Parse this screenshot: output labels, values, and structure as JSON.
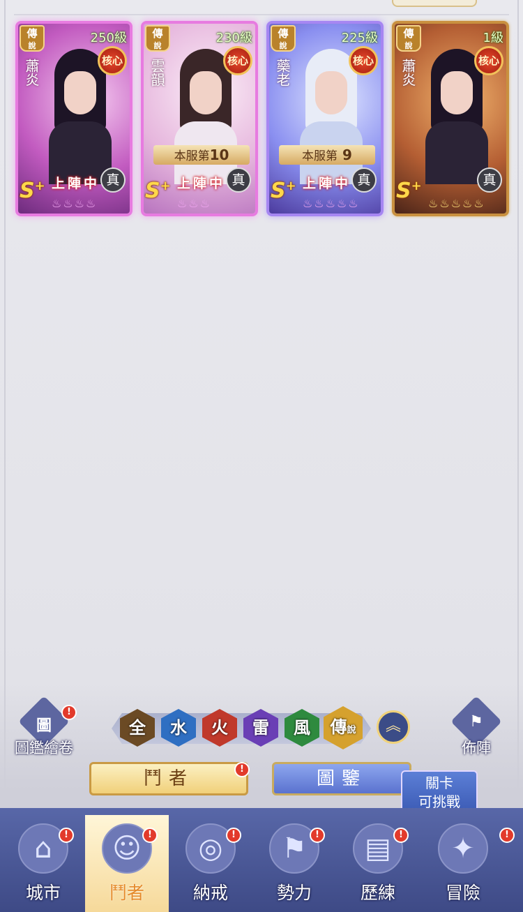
{
  "cards": [
    {
      "rarity_top": "傳",
      "rarity_bottom": "說",
      "level": "250級",
      "core": "核心",
      "name": "蕭炎",
      "rank": "",
      "deploy": "上陣中",
      "grade": "S",
      "grade_plus": "+",
      "true_label": "真",
      "stars": "♨♨♨♨",
      "theme": "pink"
    },
    {
      "rarity_top": "傳",
      "rarity_bottom": "說",
      "level": "230級",
      "core": "核心",
      "name": "雲韻",
      "rank_prefix": "本服第",
      "rank_num": "10",
      "deploy": "上陣中",
      "grade": "S",
      "grade_plus": "+",
      "true_label": "真",
      "stars": "♨♨♨",
      "theme": "pale"
    },
    {
      "rarity_top": "傳",
      "rarity_bottom": "說",
      "level": "225級",
      "core": "核心",
      "name": "藥老",
      "rank_prefix": "本服第",
      "rank_num": " 9",
      "deploy": "上陣中",
      "grade": "S",
      "grade_plus": "+",
      "true_label": "真",
      "stars": "♨♨♨♨♨",
      "theme": "purple"
    },
    {
      "rarity_top": "傳",
      "rarity_bottom": "說",
      "level": "1級",
      "core": "核心",
      "name": "蕭炎",
      "rank": "",
      "deploy": "",
      "grade": "S",
      "grade_plus": "+",
      "true_label": "真",
      "stars": "♨♨♨♨♨",
      "theme": "gold"
    }
  ],
  "left_button": {
    "glyph": "圖",
    "label": "圖鑑繪卷",
    "badge": "!"
  },
  "right_button": {
    "glyph": "⚑",
    "label": "佈陣"
  },
  "filters": [
    {
      "label": "全",
      "color": "#6b4a24"
    },
    {
      "label": "水",
      "color": "#2f6fc2"
    },
    {
      "label": "火",
      "color": "#c0392b"
    },
    {
      "label": "雷",
      "color": "#6a3fb5"
    },
    {
      "label": "風",
      "color": "#2e8a3e"
    },
    {
      "label": "傳",
      "sub": "說",
      "color": "#d5a12e",
      "active": true
    }
  ],
  "collapse_icon": "︽",
  "buttons": {
    "fighter": "鬥者",
    "codex": "圖鑒",
    "fighter_badge": "!"
  },
  "tooltip": {
    "line1": "關卡",
    "line2": "可挑戰"
  },
  "nav": [
    {
      "label": "城市",
      "sym": "⌂",
      "badge": "!"
    },
    {
      "label": "鬥者",
      "sym": "☺",
      "badge": "!",
      "active": true
    },
    {
      "label": "納戒",
      "sym": "◎",
      "badge": "!"
    },
    {
      "label": "勢力",
      "sym": "⚑",
      "badge": "!"
    },
    {
      "label": "歷練",
      "sym": "▤",
      "badge": "!"
    },
    {
      "label": "冒險",
      "sym": "✦",
      "badge": "!"
    }
  ]
}
